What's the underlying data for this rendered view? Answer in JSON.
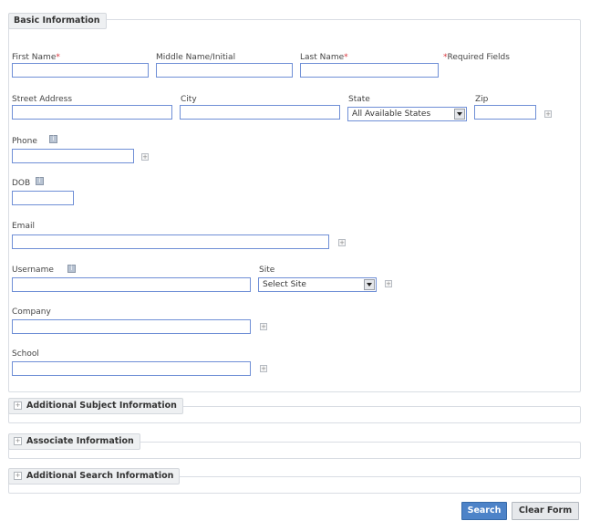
{
  "basic": {
    "legend": "Basic Information",
    "first_name": "First Name",
    "middle_name": "Middle Name/Initial",
    "last_name": "Last Name",
    "required_mark": "*",
    "required_fields": "*Required Fields",
    "street": "Street Address",
    "city": "City",
    "state": "State",
    "state_value": "All Available States",
    "zip": "Zip",
    "phone": "Phone",
    "dob": "DOB",
    "email": "Email",
    "username": "Username",
    "site": "Site",
    "site_value": "Select Site",
    "company": "Company",
    "school": "School"
  },
  "sections": {
    "subject": "Additional Subject Information",
    "associate": "Associate Information",
    "search": "Additional Search Information"
  },
  "actions": {
    "search": "Search",
    "clear": "Clear Form"
  },
  "icons": {
    "help": "i",
    "add": "+",
    "expand": "+"
  }
}
